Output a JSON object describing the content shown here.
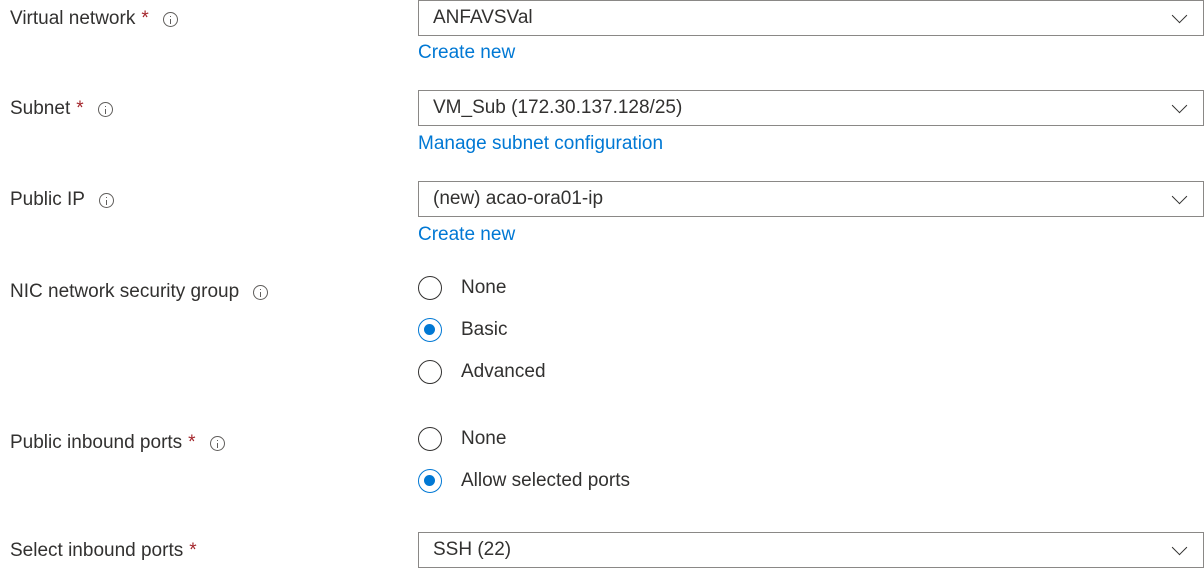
{
  "fields": {
    "virtual_network": {
      "label": "Virtual network",
      "required_mark": "*",
      "value": "ANFAVSVal",
      "link": "Create new"
    },
    "subnet": {
      "label": "Subnet",
      "required_mark": "*",
      "value": "VM_Sub (172.30.137.128/25)",
      "link": "Manage subnet configuration"
    },
    "public_ip": {
      "label": "Public IP",
      "value": "(new) acao-ora01-ip",
      "link": "Create new"
    },
    "nic_nsg": {
      "label": "NIC network security group",
      "options": [
        "None",
        "Basic",
        "Advanced"
      ],
      "selected": "Basic"
    },
    "public_inbound_ports": {
      "label": "Public inbound ports",
      "required_mark": "*",
      "options": [
        "None",
        "Allow selected ports"
      ],
      "selected": "Allow selected ports"
    },
    "select_inbound_ports": {
      "label": "Select inbound ports",
      "required_mark": "*",
      "value": "SSH (22)"
    }
  },
  "icons": {
    "info": "info-circle-icon",
    "chevron": "chevron-down-icon",
    "radio": "radio-button-icon"
  },
  "colors": {
    "accent": "#0078d4",
    "required": "#a4262c",
    "text": "#323130",
    "border": "#8a8886"
  }
}
